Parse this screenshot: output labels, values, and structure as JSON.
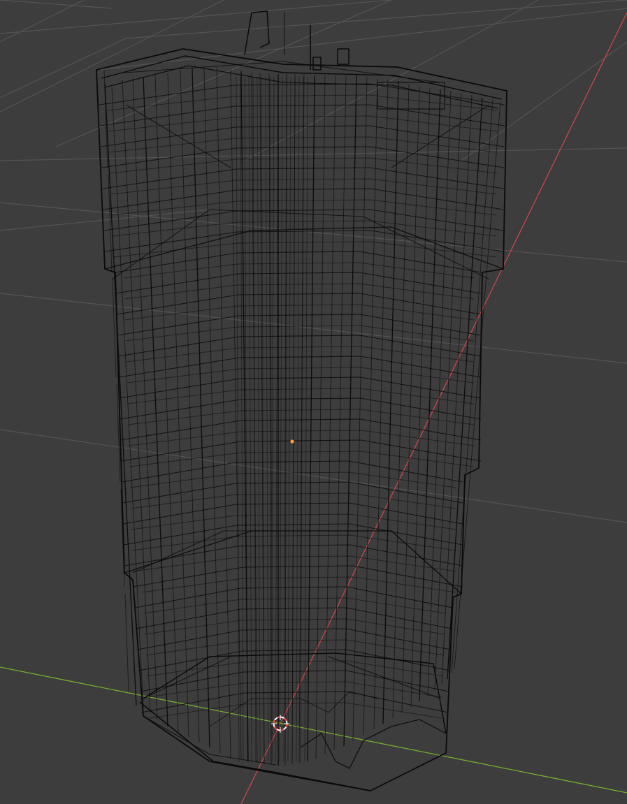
{
  "viewport": {
    "background": "#3d3d3d",
    "grid_color": "#545454",
    "x_axis_color": "#c8474f",
    "y_axis_color": "#7aad2e",
    "wire_color": "#0a0a0a",
    "origin_color": "#ffa03a",
    "cursor_color_a": "#e04040",
    "cursor_color_b": "#ffffff"
  },
  "objects": {
    "mesh": {
      "icon": "wireframe-building-mesh",
      "shading": "wireframe"
    },
    "origin": {
      "icon": "object-origin-dot"
    },
    "cursor": {
      "icon": "3d-cursor-icon"
    }
  }
}
